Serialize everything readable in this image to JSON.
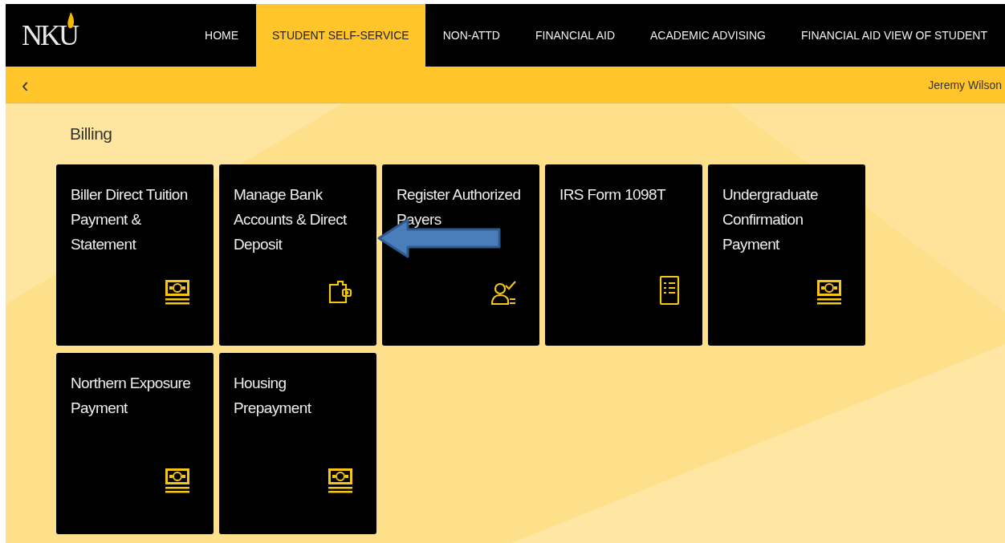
{
  "header": {
    "logo": "NKU",
    "tabs": [
      {
        "label": "HOME",
        "selected": false
      },
      {
        "label": "STUDENT SELF-SERVICE",
        "selected": true
      },
      {
        "label": "NON-ATTD",
        "selected": false
      },
      {
        "label": "FINANCIAL AID",
        "selected": false
      },
      {
        "label": "ACADEMIC ADVISING",
        "selected": false
      },
      {
        "label": "FINANCIAL AID VIEW OF STUDENT",
        "selected": false
      }
    ]
  },
  "subbar": {
    "back": "‹",
    "user": "Jeremy Wilson"
  },
  "section": {
    "title": "Billing",
    "tiles": [
      {
        "title": "Biller Direct Tuition Payment & Statement",
        "kind": "money"
      },
      {
        "title": "Manage Bank Accounts & Direct Deposit",
        "kind": "wallet"
      },
      {
        "title": "Register Authorized Payers",
        "kind": "payer"
      },
      {
        "title": "IRS Form 1098T",
        "kind": "document"
      },
      {
        "title": "Undergraduate Confirmation Payment",
        "kind": "money"
      },
      {
        "title": "Northern Exposure Payment",
        "kind": "money"
      },
      {
        "title": "Housing Prepayment",
        "kind": "money"
      }
    ]
  }
}
